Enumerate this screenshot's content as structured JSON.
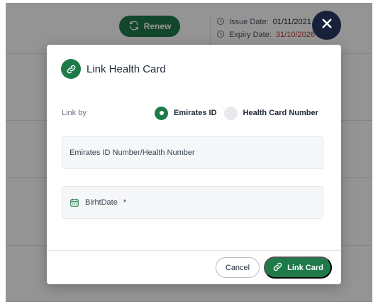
{
  "background": {
    "renew_label": "Renew",
    "issue_label": "Issue Date:",
    "issue_value": "01/11/2021",
    "expiry_label": "Expiry Date:",
    "expiry_value": "31/10/2026"
  },
  "modal": {
    "title": "Link Health Card",
    "link_by_label": "Link by",
    "options": [
      "Emirates ID",
      "Health Card Number"
    ],
    "selected_option": "Emirates ID",
    "id_field_placeholder": "Emirates ID Number/Health Number",
    "birthdate_label": "BirhtDate",
    "birthdate_required_mark": "*",
    "cancel_label": "Cancel",
    "link_card_label": "Link Card"
  },
  "colors": {
    "accent": "#1f7a4a",
    "close_button": "#17213a",
    "expiry_value": "#c0392b"
  },
  "icons": {
    "header": "link-icon",
    "close": "close-icon",
    "birthdate": "calendar-icon",
    "renew": "refresh-icon",
    "dates": "clock-icon",
    "link_button": "link-icon"
  }
}
